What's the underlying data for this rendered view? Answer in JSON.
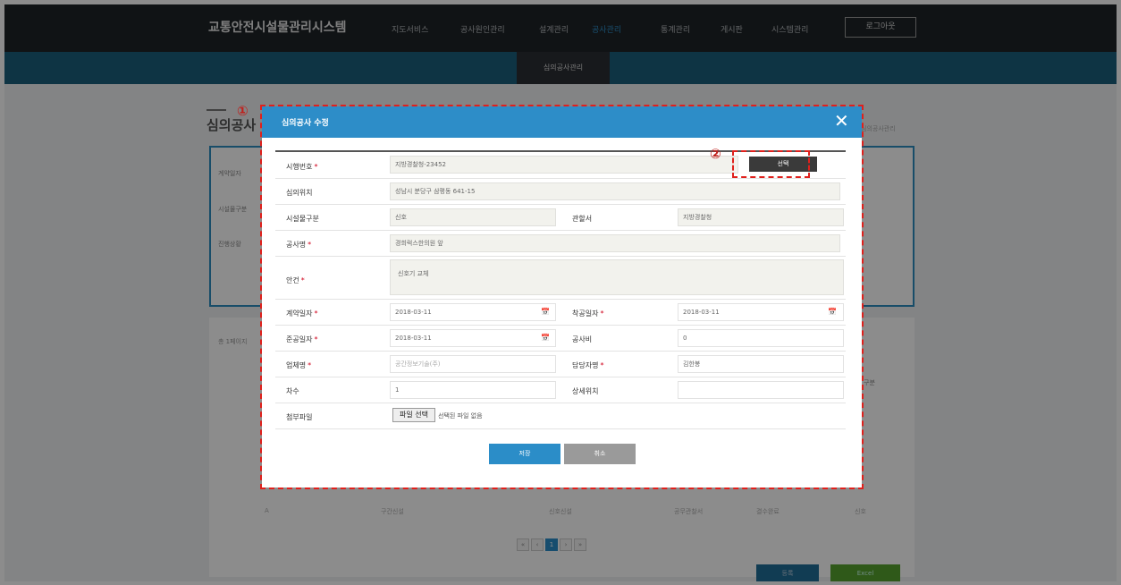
{
  "app": {
    "title": "교통안전시설물관리시스템",
    "logout": "로그아웃"
  },
  "nav": [
    "지도서비스",
    "공사원인관리",
    "설계관리",
    "공사관리",
    "통계관리",
    "게시판",
    "시스템관리"
  ],
  "subnav": {
    "active": "심의공사관리"
  },
  "background": {
    "page_title": "심의공사",
    "breadcrumb": "심의공사관리",
    "filters": [
      "계약일자",
      "시설물구분",
      "진행상황"
    ],
    "count": "총 1페이지",
    "col_last": "구분",
    "row_cells": [
      "A",
      "구간신설",
      "신호신설",
      "공무관찰서",
      "결수완료",
      "신호"
    ],
    "pager": [
      "«",
      "‹",
      "1",
      "›",
      "»"
    ],
    "btn_register": "등록",
    "btn_excel": "Excel"
  },
  "modal": {
    "title": "심의공사 수정",
    "close": "✕",
    "fields": {
      "permit_no": {
        "label": "시행번호",
        "value": "지방경찰청-23452"
      },
      "location": {
        "label": "심의위치",
        "value": "성남시 분당구 삼평동 641-15"
      },
      "facility": {
        "label": "시설물구분",
        "value": "신호"
      },
      "authority": {
        "label": "관할서",
        "value": "지방경찰청"
      },
      "work_name": {
        "label": "공사명",
        "value": "경희럭스한의원 앞"
      },
      "agenda": {
        "label": "안건",
        "value": "신호기 교체"
      },
      "contract_date": {
        "label": "계약일자",
        "value": "2018-03-11"
      },
      "start_date": {
        "label": "착공일자",
        "value": "2018-03-11"
      },
      "finish_date": {
        "label": "준공일자",
        "value": "2018-03-11"
      },
      "cost": {
        "label": "공사비",
        "value": "0"
      },
      "company": {
        "label": "업체명",
        "placeholder": "공간정보기술(주)"
      },
      "manager": {
        "label": "담당자명",
        "value": "김한봉"
      },
      "round": {
        "label": "차수",
        "value": "1"
      },
      "detail_location": {
        "label": "상세위치",
        "value": ""
      },
      "attachment": {
        "label": "첨부파일",
        "button": "파일 선택",
        "status": "선택된 파일 없음"
      }
    },
    "select_btn": "선택",
    "required_mark": "*",
    "calendar_icon": "📅",
    "save": "저장",
    "cancel": "취소"
  },
  "annotations": {
    "one": "①",
    "two": "②",
    "color": "#e0201c"
  }
}
